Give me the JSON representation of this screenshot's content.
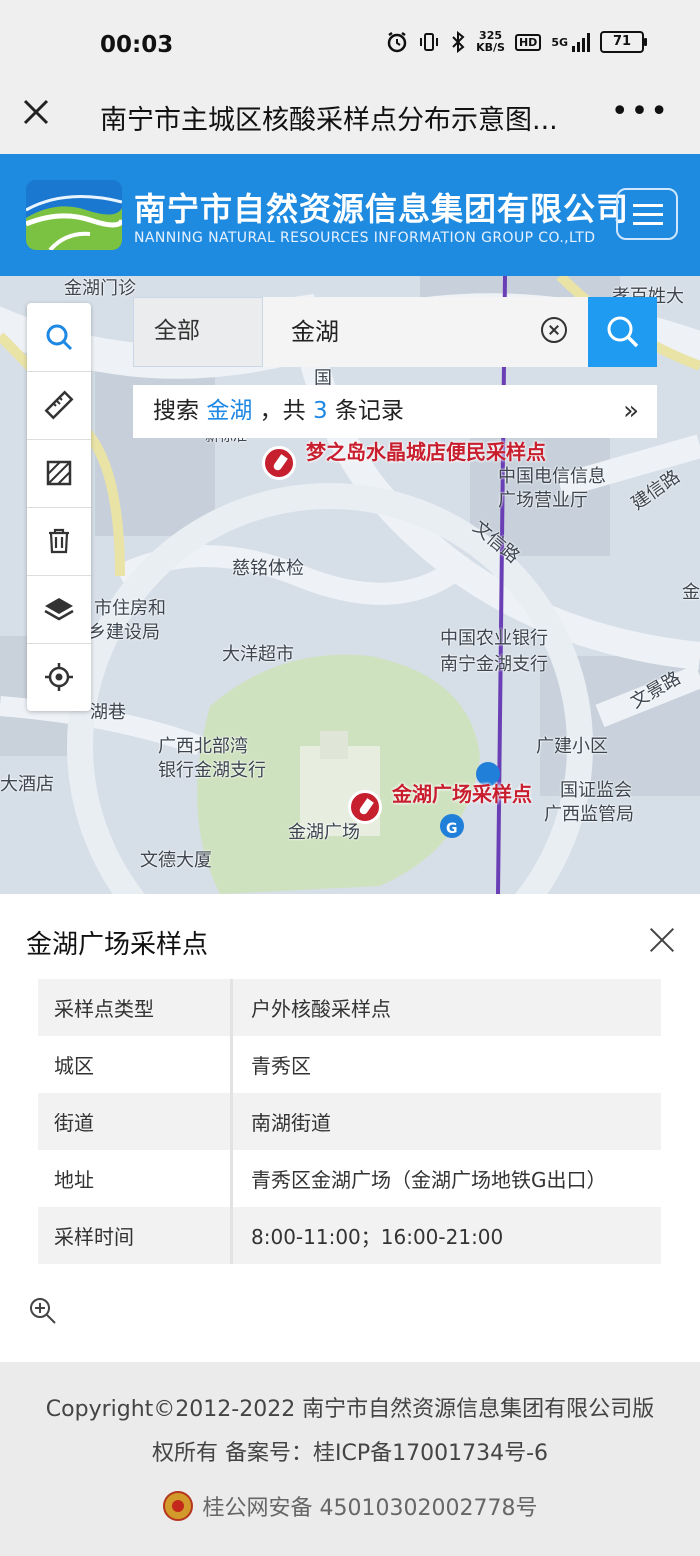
{
  "status_bar": {
    "time": "00:03",
    "net_speed": "325",
    "net_unit": "KB/S",
    "hd": "HD",
    "net_type": "5G",
    "battery": "71"
  },
  "title_bar": {
    "title": "南宁市主城区核酸采样点分布示意图...",
    "more": "•••"
  },
  "header": {
    "company_cn": "南宁市自然资源信息集团有限公司",
    "company_en": "NANNING NATURAL RESOURCES INFORMATION GROUP CO.,LTD"
  },
  "map": {
    "labels": {
      "l1": "金湖门诊",
      "l2": "孝百姓大",
      "l3": "国",
      "l4": "新标准",
      "l5": "中国电信信息",
      "l6": "广场营业厅",
      "l7": "建信路",
      "l8": "文信路",
      "l9": "慈铭体检",
      "l10": "市住房和",
      "l11": "乡建设局",
      "l12": "中国农业银行",
      "l13": "南宁金湖支行",
      "l14": "大洋超市",
      "l15": "文景路",
      "l16": "湖巷",
      "l17": "广西北部湾",
      "l18": "银行金湖支行",
      "l19": "广建小区",
      "l20": "大酒店",
      "l21": "国证监会",
      "l22": "广西监管局",
      "l23": "金湖广场",
      "l24": "文德大厦",
      "l25": "金"
    },
    "poi_1": "梦之岛水晶城店便民采样点",
    "poi_2": "金湖广场采样点"
  },
  "colors": {
    "brand_blue": "#1e8ae0",
    "search_blue": "#1f9bf1",
    "poi_red": "#c81e2e",
    "metro_purple": "#6a3fb5"
  },
  "toolbar": [
    "search-icon",
    "ruler-icon",
    "area-measure-icon",
    "trash-icon",
    "layers-icon",
    "locate-icon"
  ],
  "search": {
    "scope": "全部",
    "query": "金湖"
  },
  "result": {
    "prefix": "搜索",
    "keyword": "金湖",
    "middle": "，共",
    "count": "3",
    "suffix": "条记录",
    "more": "»"
  },
  "panel": {
    "title": "金湖广场采样点",
    "rows": [
      {
        "k": "采样点类型",
        "v": "户外核酸采样点"
      },
      {
        "k": "城区",
        "v": "青秀区"
      },
      {
        "k": "街道",
        "v": "南湖街道"
      },
      {
        "k": "地址",
        "v": "青秀区金湖广场（金湖广场地铁G出口）"
      },
      {
        "k": "采样时间",
        "v": "8:00-11:00；16:00-21:00"
      }
    ]
  },
  "footer": {
    "copyright_line1": "Copyright©2012-2022 南宁市自然资源信息集团有限公司版",
    "copyright_line2": "权所有 备案号：桂ICP备17001734号-6",
    "police": "桂公网安备 45010302002778号"
  }
}
